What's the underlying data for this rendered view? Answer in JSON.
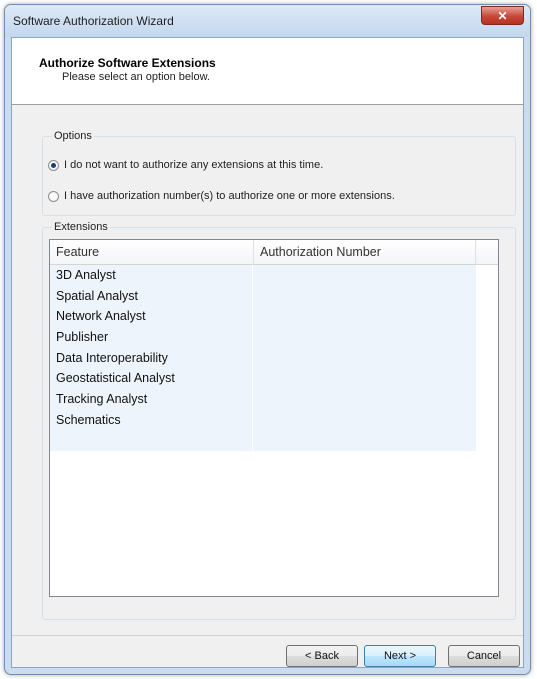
{
  "window": {
    "title": "Software Authorization Wizard",
    "close_glyph": "✕"
  },
  "header": {
    "title": "Authorize Software Extensions",
    "subtitle": "Please select an option below."
  },
  "options": {
    "group_label": "Options",
    "radio_none_label": "I do not want to authorize any extensions at this time.",
    "radio_have_label": "I have authorization number(s) to authorize one or more extensions.",
    "selected": "none"
  },
  "extensions": {
    "group_label": "Extensions",
    "columns": [
      "Feature",
      "Authorization Number"
    ],
    "rows": [
      {
        "feature": "3D Analyst",
        "auth": ""
      },
      {
        "feature": "Spatial Analyst",
        "auth": ""
      },
      {
        "feature": "Network Analyst",
        "auth": ""
      },
      {
        "feature": "Publisher",
        "auth": ""
      },
      {
        "feature": "Data Interoperability",
        "auth": ""
      },
      {
        "feature": "Geostatistical Analyst",
        "auth": ""
      },
      {
        "feature": "Tracking Analyst",
        "auth": ""
      },
      {
        "feature": "Schematics",
        "auth": ""
      },
      {
        "feature": "",
        "auth": ""
      }
    ]
  },
  "buttons": {
    "back": "< Back",
    "next": "Next >",
    "cancel": "Cancel"
  },
  "colors": {
    "close_button": "#c7473a",
    "row_fill": "#eef4fb",
    "default_button": "#3c7fb1"
  }
}
